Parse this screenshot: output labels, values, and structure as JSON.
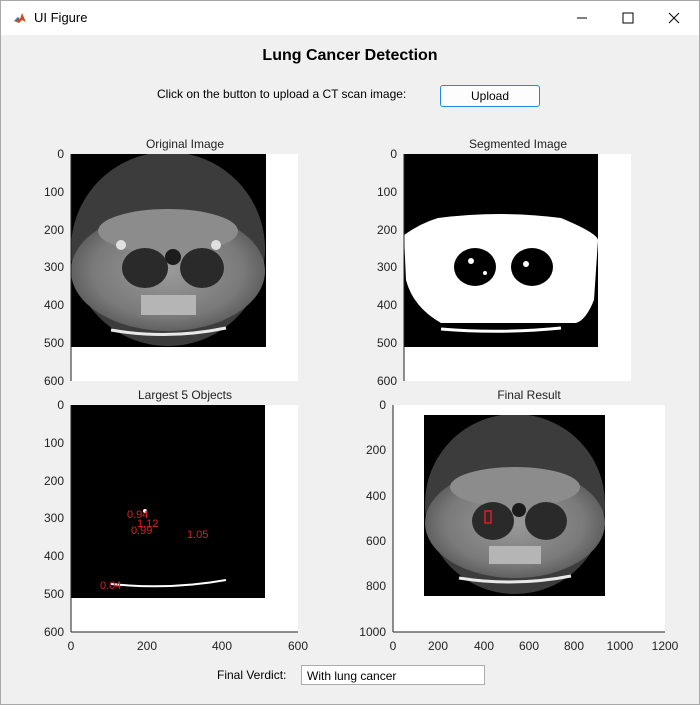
{
  "window": {
    "title": "UI Figure",
    "icon": "matlab-icon"
  },
  "header": {
    "title": "Lung Cancer Detection"
  },
  "upload": {
    "instruction": "Click on the button to upload a CT scan image:",
    "button_label": "Upload"
  },
  "axes": {
    "original": {
      "title": "Original Image",
      "yticks": [
        "0",
        "100",
        "200",
        "300",
        "400",
        "500",
        "600"
      ]
    },
    "segmented": {
      "title": "Segmented Image",
      "yticks": [
        "0",
        "100",
        "200",
        "300",
        "400",
        "500",
        "600"
      ]
    },
    "largest": {
      "title": "Largest 5 Objects",
      "yticks": [
        "0",
        "100",
        "200",
        "300",
        "400",
        "500",
        "600"
      ],
      "xticks": [
        "0",
        "200",
        "400",
        "600"
      ],
      "labels": [
        "0.94",
        "1.12",
        "0.99",
        "1.05",
        "0.04"
      ]
    },
    "final": {
      "title": "Final Result",
      "yticks": [
        "0",
        "200",
        "400",
        "600",
        "800",
        "1000"
      ],
      "xticks": [
        "0",
        "200",
        "400",
        "600",
        "800",
        "1000",
        "1200"
      ]
    }
  },
  "verdict": {
    "label": "Final Verdict:",
    "value": "With lung cancer"
  },
  "colors": {
    "accent": "#1a8ae0",
    "label_red": "#e02020"
  }
}
